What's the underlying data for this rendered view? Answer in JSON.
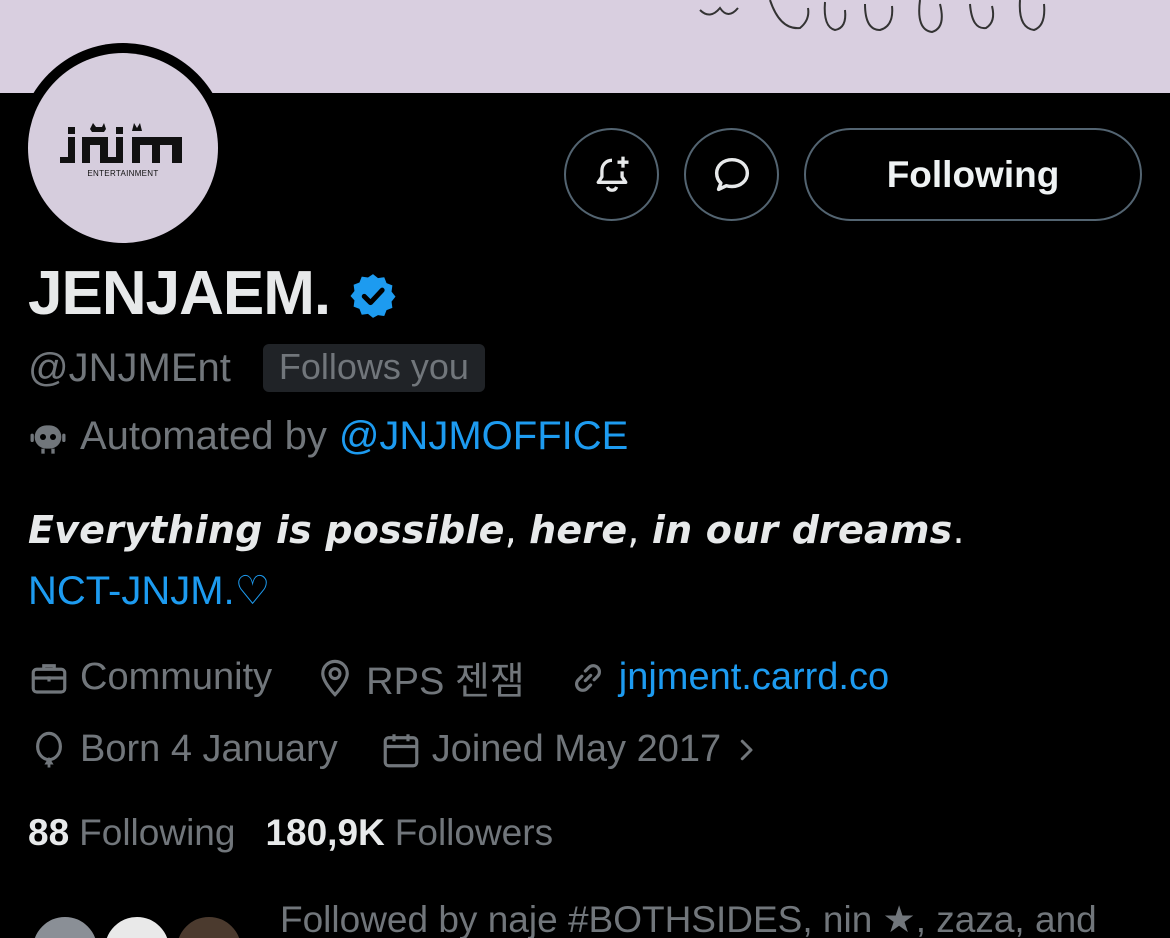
{
  "profile": {
    "display_name": "JENJAEM.",
    "handle": "@JNJMEnt",
    "follows_you": "Follows you",
    "avatar_caption": "ENTERTAINMENT",
    "automated_prefix": "Automated by",
    "automated_link": "@JNJMOFFICE",
    "bio_bold1": "Everything is possible",
    "bio_sep1": ", ",
    "bio_bold2": "here",
    "bio_sep2": ", ",
    "bio_bold3": "in our dreams",
    "bio_sep3": ".",
    "bio_link": "NCT-JNJM.♡",
    "category": "Community",
    "location": "RPS 젠잼",
    "website": "jnjment.carrd.co",
    "birthday": "Born 4 January",
    "joined": "Joined May 2017",
    "following_count": "88",
    "following_label": "Following",
    "followers_count": "180,9K",
    "followers_label": "Followers",
    "followed_by": "Followed by naje #BOTHSIDES, nin ★, zaza, and"
  },
  "actions": {
    "following_button": "Following"
  },
  "colors": {
    "accent": "#1d9bf0",
    "muted": "#71767b",
    "banner": "#d9cfe0",
    "avatar_bg": "#d6cddd"
  },
  "icons": [
    "bell-plus-icon",
    "message-icon",
    "verified-badge-icon",
    "robot-icon",
    "briefcase-icon",
    "location-pin-icon",
    "link-icon",
    "balloon-icon",
    "calendar-icon",
    "chevron-right-icon"
  ]
}
